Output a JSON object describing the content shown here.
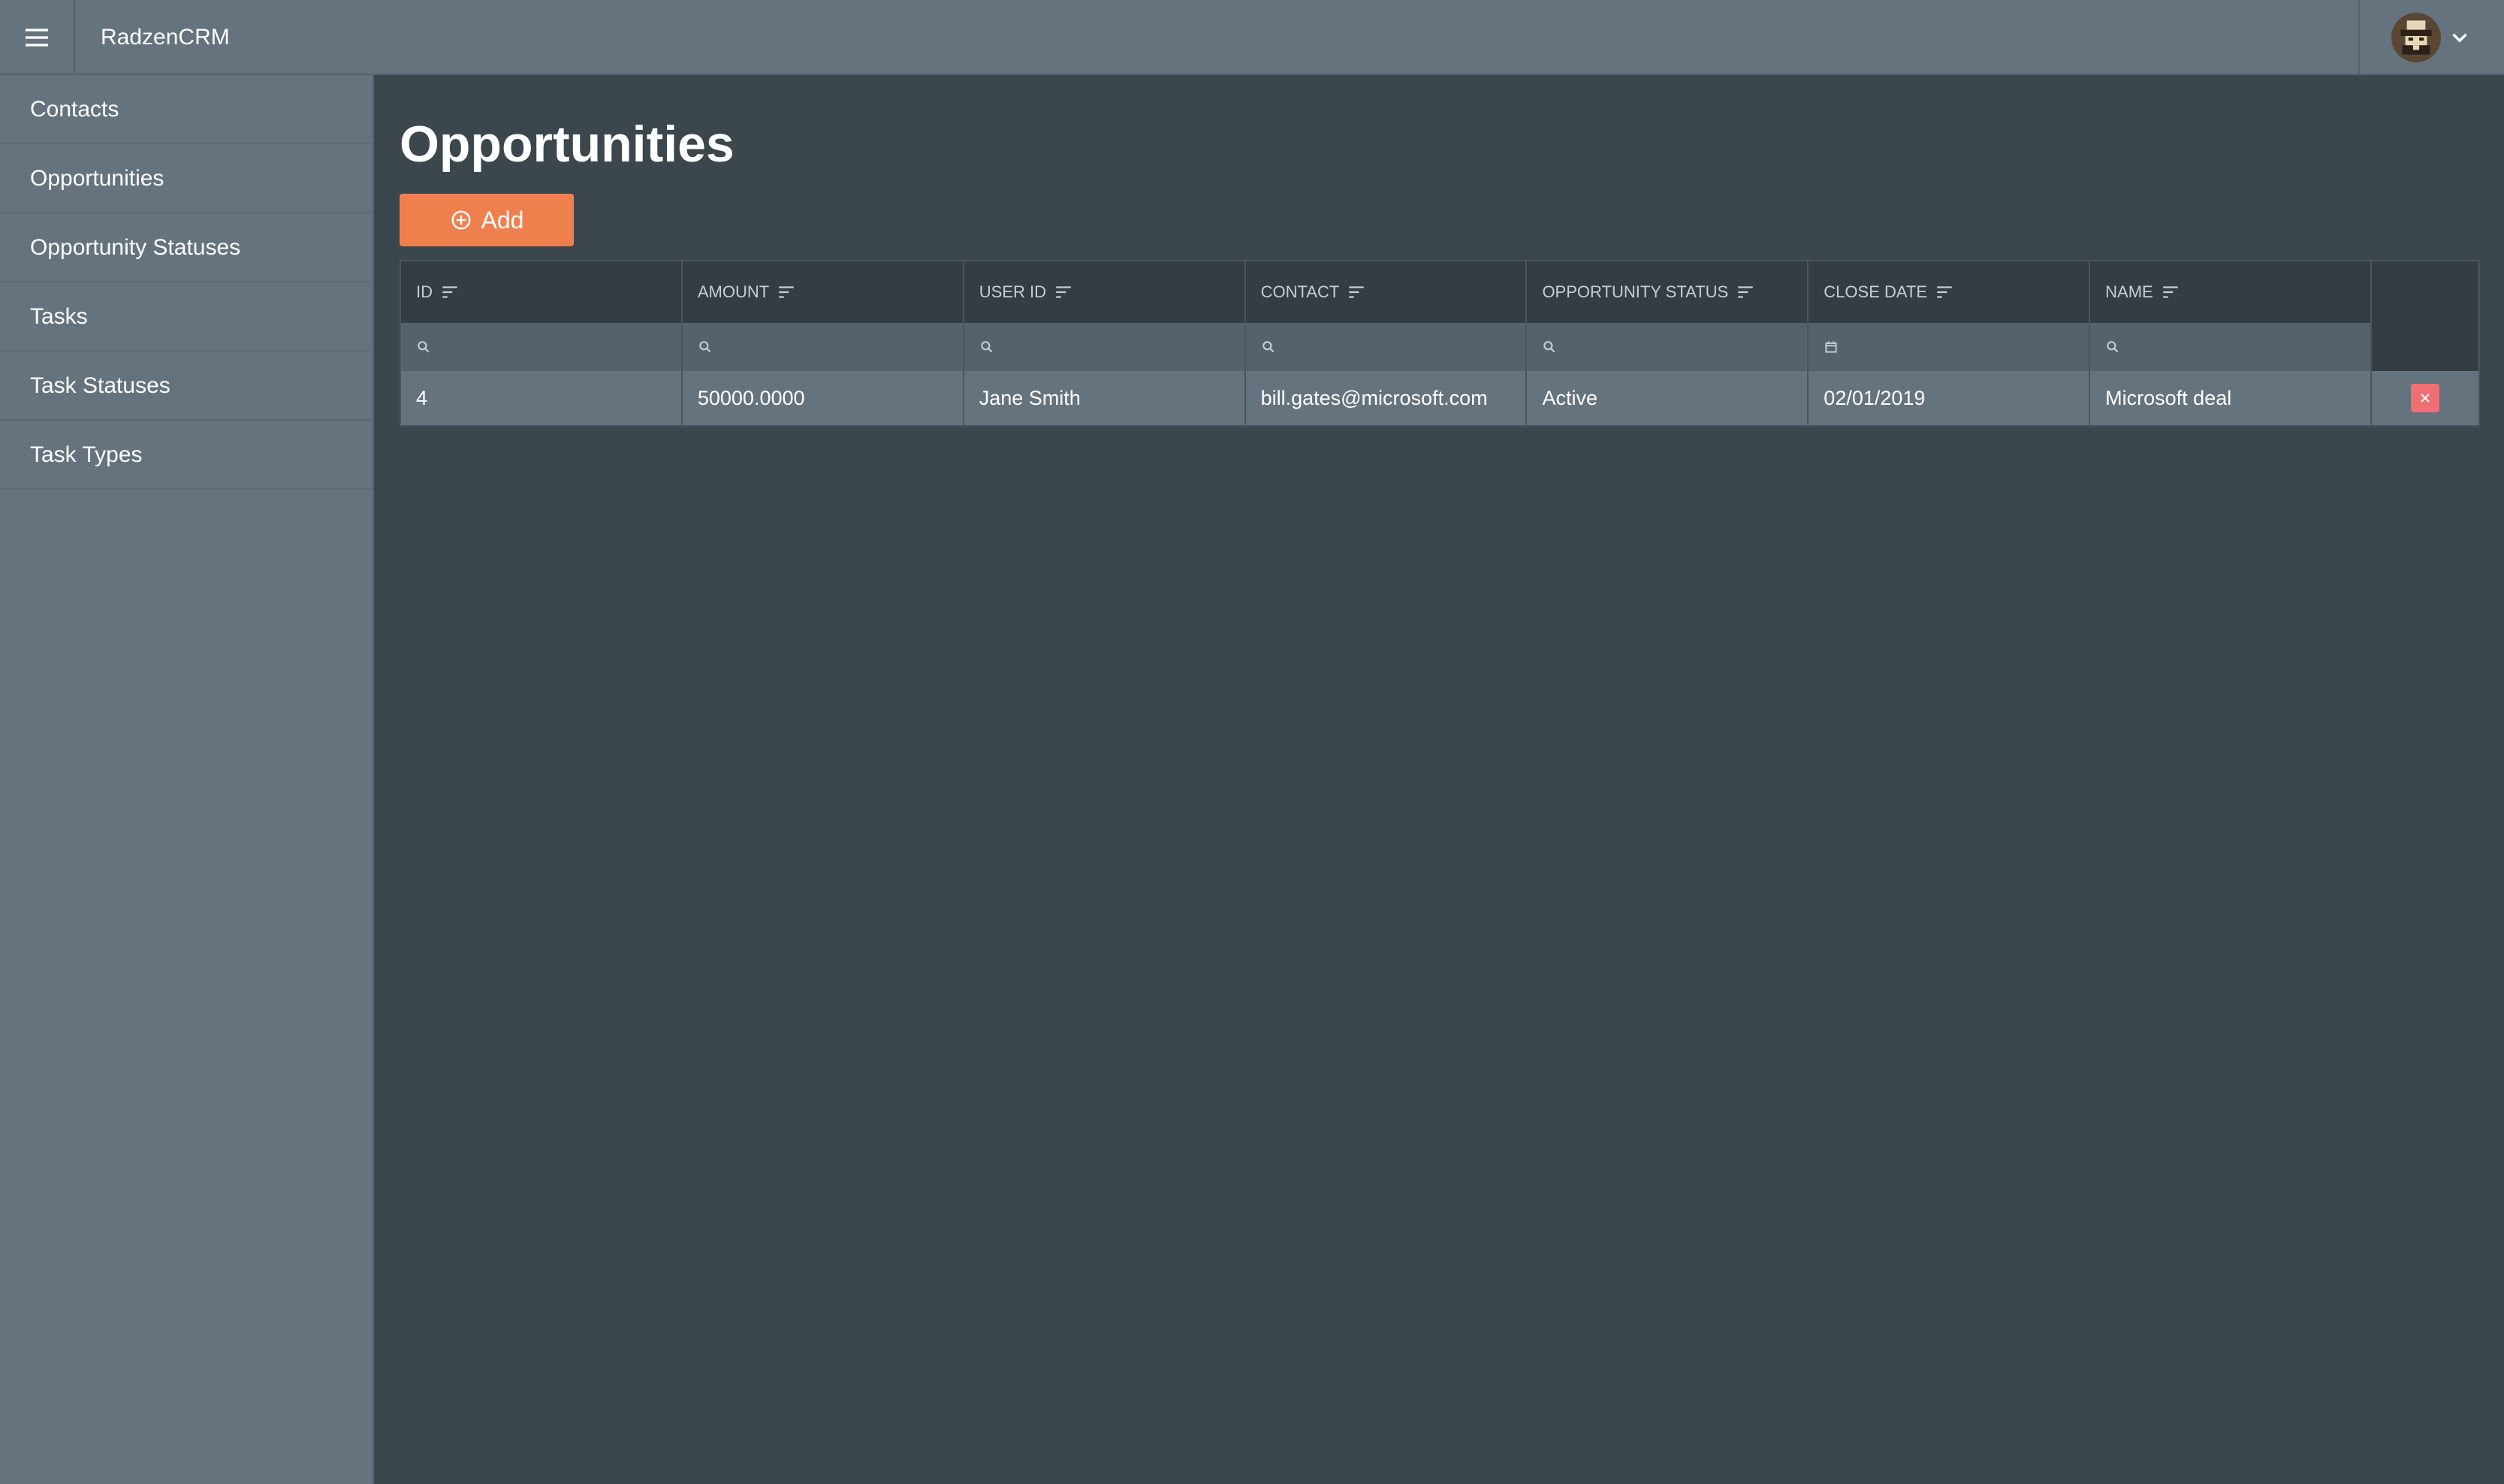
{
  "app": {
    "title": "RadzenCRM"
  },
  "icons": {
    "menu": "hamburger-icon",
    "avatar": "user-avatar-icon",
    "chevron": "chevron-down-icon",
    "add": "plus-circle-icon",
    "sort": "sort-icon",
    "search": "search-icon",
    "calendar": "calendar-icon",
    "delete": "close-icon"
  },
  "colors": {
    "topbar": "#65737e",
    "sidebar": "#65737e",
    "content": "#3c464d",
    "accent": "#f07f4e",
    "danger": "#ef6f73"
  },
  "sidebar": {
    "items": [
      {
        "label": "Contacts"
      },
      {
        "label": "Opportunities"
      },
      {
        "label": "Opportunity Statuses"
      },
      {
        "label": "Tasks"
      },
      {
        "label": "Task Statuses"
      },
      {
        "label": "Task Types"
      }
    ]
  },
  "main": {
    "title": "Opportunities",
    "add_label": "Add"
  },
  "grid": {
    "columns": [
      {
        "label": "ID",
        "filter": "search"
      },
      {
        "label": "Amount",
        "filter": "search"
      },
      {
        "label": "User ID",
        "filter": "search"
      },
      {
        "label": "Contact",
        "filter": "search"
      },
      {
        "label": "Opportunity Status",
        "filter": "search"
      },
      {
        "label": "Close Date",
        "filter": "calendar"
      },
      {
        "label": "Name",
        "filter": "search"
      }
    ],
    "rows": [
      {
        "id": "4",
        "amount": "50000.0000",
        "user_id": "Jane Smith",
        "contact": "bill.gates@microsoft.com",
        "status": "Active",
        "close_date": "02/01/2019",
        "name": "Microsoft deal"
      }
    ]
  }
}
